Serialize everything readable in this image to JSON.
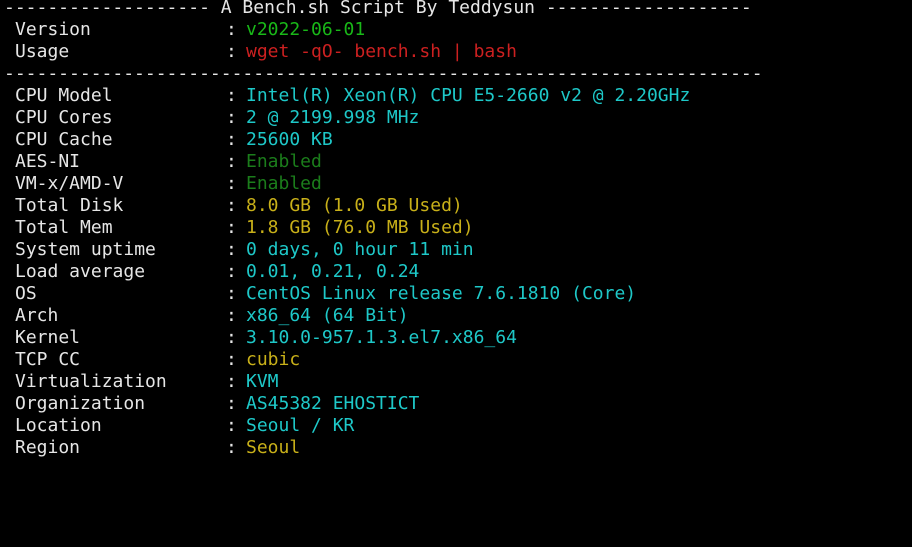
{
  "header": {
    "top_separator": "------------------- A Bench.sh Script By Teddysun -------------------",
    "mid_separator": "----------------------------------------------------------------------"
  },
  "meta": [
    {
      "key": "Version",
      "value": "v2022-06-01",
      "color": "#19b818"
    },
    {
      "key": "Usage",
      "value": "wget -qO- bench.sh | bash",
      "color": "#cc2020"
    }
  ],
  "system_info": [
    {
      "key": "CPU Model",
      "value": "Intel(R) Xeon(R) CPU E5-2660 v2 @ 2.20GHz",
      "color": "#1ec8c8"
    },
    {
      "key": "CPU Cores",
      "value": "2 @ 2199.998 MHz",
      "color": "#1ec8c8"
    },
    {
      "key": "CPU Cache",
      "value": "25600 KB",
      "color": "#1ec8c8"
    },
    {
      "key": "AES-NI",
      "value": "Enabled",
      "color": "#1b7d1b"
    },
    {
      "key": "VM-x/AMD-V",
      "value": "Enabled",
      "color": "#1b7d1b"
    },
    {
      "key": "Total Disk",
      "value": "8.0 GB (1.0 GB Used)",
      "color": "#c8b019"
    },
    {
      "key": "Total Mem",
      "value": "1.8 GB (76.0 MB Used)",
      "color": "#c8b019"
    },
    {
      "key": "System uptime",
      "value": "0 days, 0 hour 11 min",
      "color": "#1ec8c8"
    },
    {
      "key": "Load average",
      "value": "0.01, 0.21, 0.24",
      "color": "#1ec8c8"
    },
    {
      "key": "OS",
      "value": "CentOS Linux release 7.6.1810 (Core)",
      "color": "#1ec8c8"
    },
    {
      "key": "Arch",
      "value": "x86_64 (64 Bit)",
      "color": "#1ec8c8"
    },
    {
      "key": "Kernel",
      "value": "3.10.0-957.1.3.el7.x86_64",
      "color": "#1ec8c8"
    },
    {
      "key": "TCP CC",
      "value": "cubic",
      "color": "#c8b019"
    },
    {
      "key": "Virtualization",
      "value": "KVM",
      "color": "#1ec8c8"
    },
    {
      "key": "Organization",
      "value": "AS45382 EHOSTICT",
      "color": "#1ec8c8"
    },
    {
      "key": "Location",
      "value": "Seoul / KR",
      "color": "#1ec8c8"
    },
    {
      "key": "Region",
      "value": "Seoul",
      "color": "#c8b019"
    }
  ],
  "colon": ":"
}
